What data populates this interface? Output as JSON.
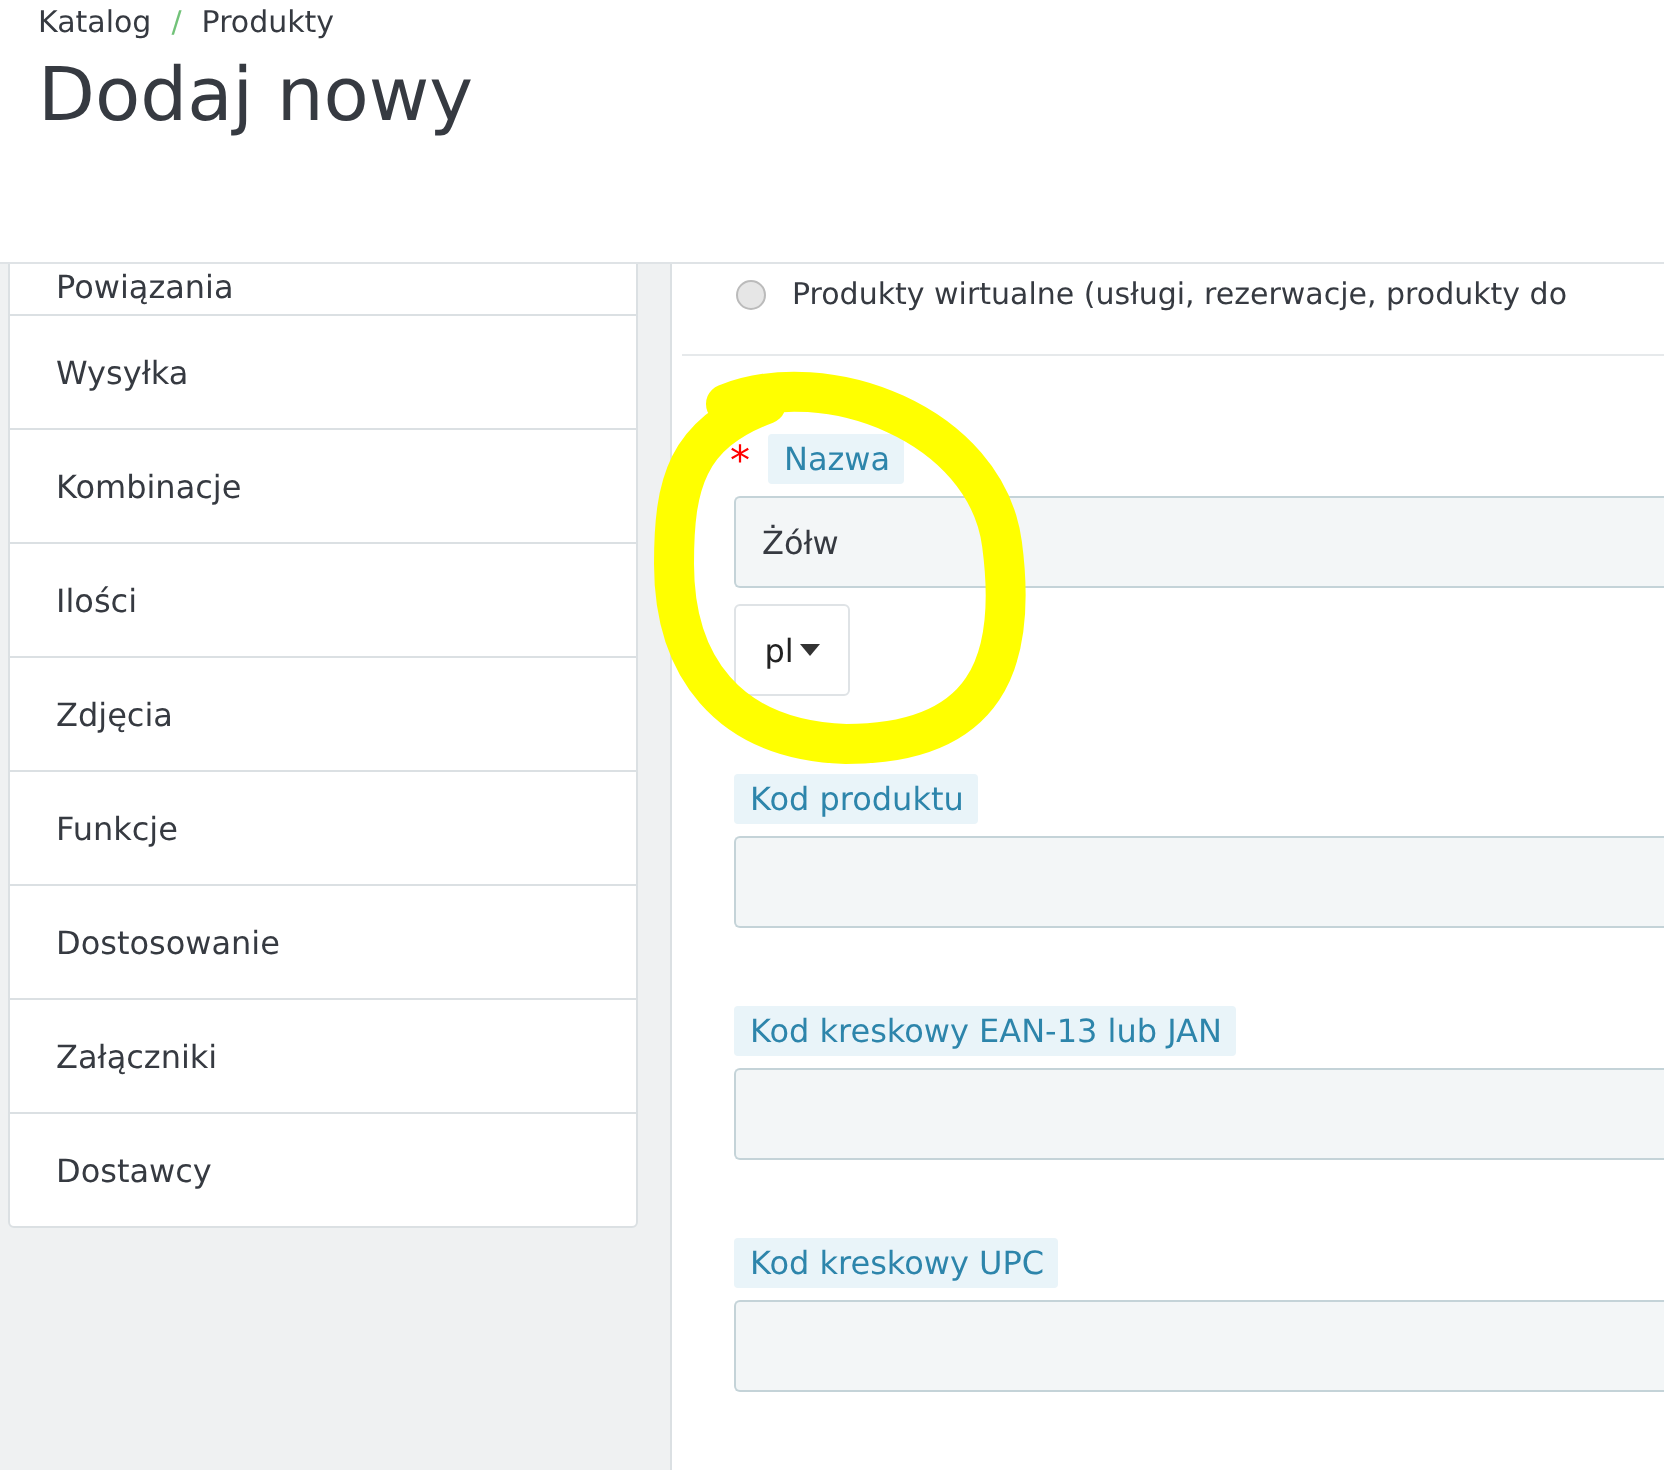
{
  "breadcrumb": {
    "items": [
      "Katalog",
      "Produkty"
    ],
    "separator": "/"
  },
  "title": "Dodaj nowy",
  "sidebar": {
    "items": [
      {
        "label": "Powiązania"
      },
      {
        "label": "Wysyłka"
      },
      {
        "label": "Kombinacje"
      },
      {
        "label": "Ilości"
      },
      {
        "label": "Zdjęcia"
      },
      {
        "label": "Funkcje"
      },
      {
        "label": "Dostosowanie"
      },
      {
        "label": "Załączniki"
      },
      {
        "label": "Dostawcy"
      }
    ]
  },
  "product_type": {
    "label": "Produkty wirtualne (usługi, rezerwacje, produkty do",
    "selected": false
  },
  "fields": [
    {
      "label": "Nazwa",
      "required_mark": "*",
      "value": "Żółw",
      "language": "pl"
    },
    {
      "label": "Kod produktu"
    },
    {
      "label": "Kod kreskowy EAN-13 lub JAN"
    },
    {
      "label": "Kod kreskowy UPC"
    }
  ],
  "annotation": {
    "kind": "circle",
    "color": "#ffff00"
  }
}
